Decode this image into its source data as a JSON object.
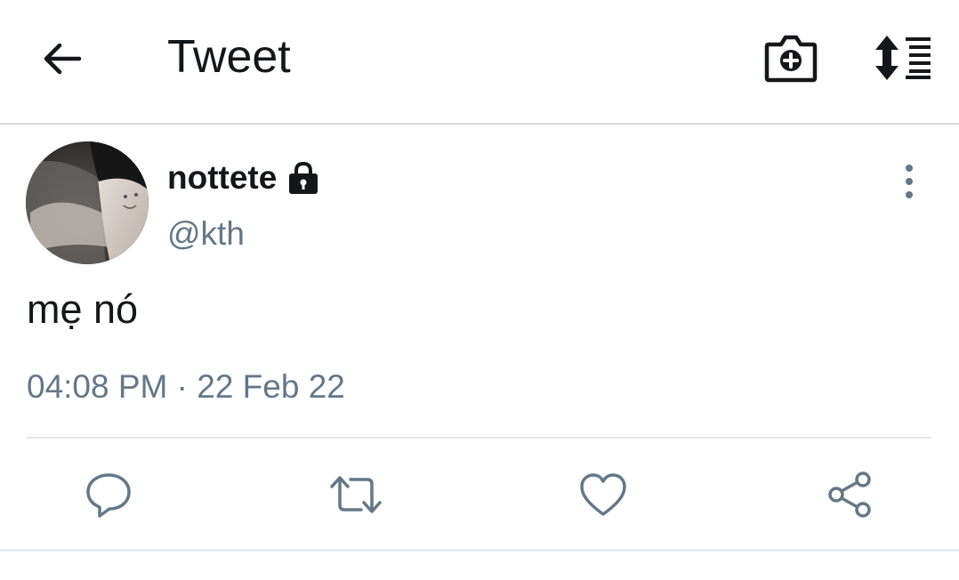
{
  "header": {
    "title": "Tweet",
    "back_icon": "arrow-left-icon",
    "camera_icon": "camera-add-icon",
    "sort_icon": "sort-list-icon"
  },
  "tweet": {
    "display_name": "nottete",
    "protected_icon": "lock-icon",
    "handle": "@kth",
    "text": "mẹ nó",
    "timestamp": "04:08 PM · 22 Feb 22",
    "more_icon": "more-vertical-icon"
  },
  "actions": [
    {
      "icon": "reply-icon"
    },
    {
      "icon": "retweet-icon"
    },
    {
      "icon": "like-icon"
    },
    {
      "icon": "share-icon"
    }
  ],
  "colors": {
    "primary_text": "#14171a",
    "secondary_text": "#657786",
    "icon": "#657786",
    "divider": "#e1e8ed"
  }
}
